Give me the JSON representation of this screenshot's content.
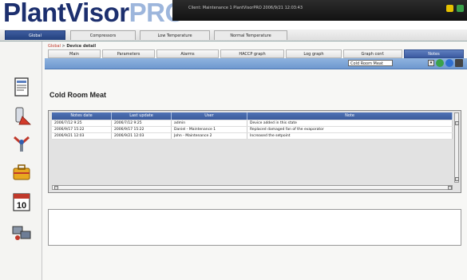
{
  "app": {
    "logo_main": "PlantVisor",
    "logo_pro": "PRO",
    "logo_reg": "®",
    "status_line": "Client: Maintenance 1 PlantVisorPRO 2006/9/21 12:03:43"
  },
  "main_tabs": [
    {
      "label": "Global"
    },
    {
      "label": "Compressors"
    },
    {
      "label": "Low Temperature"
    },
    {
      "label": "Normal Temperature"
    }
  ],
  "breadcrumb": {
    "link": "Global",
    "separator": " > ",
    "current": "Device detail"
  },
  "sub_tabs": [
    {
      "label": "Main"
    },
    {
      "label": "Parameters"
    },
    {
      "label": "Alarms"
    },
    {
      "label": "HACCP graph"
    },
    {
      "label": "Log graph"
    },
    {
      "label": "Graph conf."
    },
    {
      "label": "Notes"
    }
  ],
  "device_select": {
    "value": "Cold Room Meat"
  },
  "page": {
    "title": "Cold Room Meat"
  },
  "notes_table": {
    "columns": [
      "Notes date",
      "Last update",
      "User",
      "Note"
    ],
    "rows": [
      [
        "2006/7/12 9:25",
        "2006/7/12 9:25",
        "admin",
        "Device added in this state"
      ],
      [
        "2006/9/17 15:22",
        "2006/9/17 15:22",
        "Daniel - Maintenance 1",
        "Replaced damaged fan of the evaporator"
      ],
      [
        "2006/9/21 12:03",
        "2006/9/21 12:03",
        "John - Maintenance 2",
        "Increased the setpoint"
      ]
    ]
  },
  "colors": {
    "brand_dark": "#1c2f6e",
    "brand_light": "#9db6dc",
    "tab_active": "#3b5aa0",
    "toolbar": "#7ca2d6"
  },
  "icons": {
    "sidebar": [
      "document-icon",
      "alarm-bell-icon",
      "tools-icon",
      "toolbox-icon",
      "calendar-icon",
      "network-icon"
    ],
    "calendar_day": "10"
  }
}
